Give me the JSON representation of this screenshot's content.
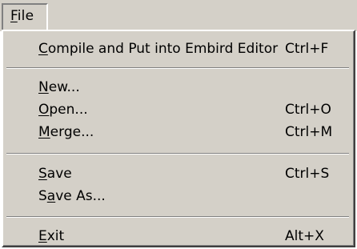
{
  "menubar": {
    "file": {
      "pre": "",
      "acc": "F",
      "post": "ile"
    }
  },
  "menu": {
    "items": [
      {
        "pre": "",
        "acc": "C",
        "post": "ompile and Put into Embird Editor",
        "shortcut": "Ctrl+F"
      },
      {
        "pre": "",
        "acc": "N",
        "post": "ew...",
        "shortcut": ""
      },
      {
        "pre": "",
        "acc": "O",
        "post": "pen...",
        "shortcut": "Ctrl+O"
      },
      {
        "pre": "",
        "acc": "M",
        "post": "erge...",
        "shortcut": "Ctrl+M"
      },
      {
        "pre": "",
        "acc": "S",
        "post": "ave",
        "shortcut": "Ctrl+S"
      },
      {
        "pre": "S",
        "acc": "a",
        "post": "ve As...",
        "shortcut": ""
      },
      {
        "pre": "",
        "acc": "E",
        "post": "xit",
        "shortcut": "Alt+X"
      }
    ]
  }
}
